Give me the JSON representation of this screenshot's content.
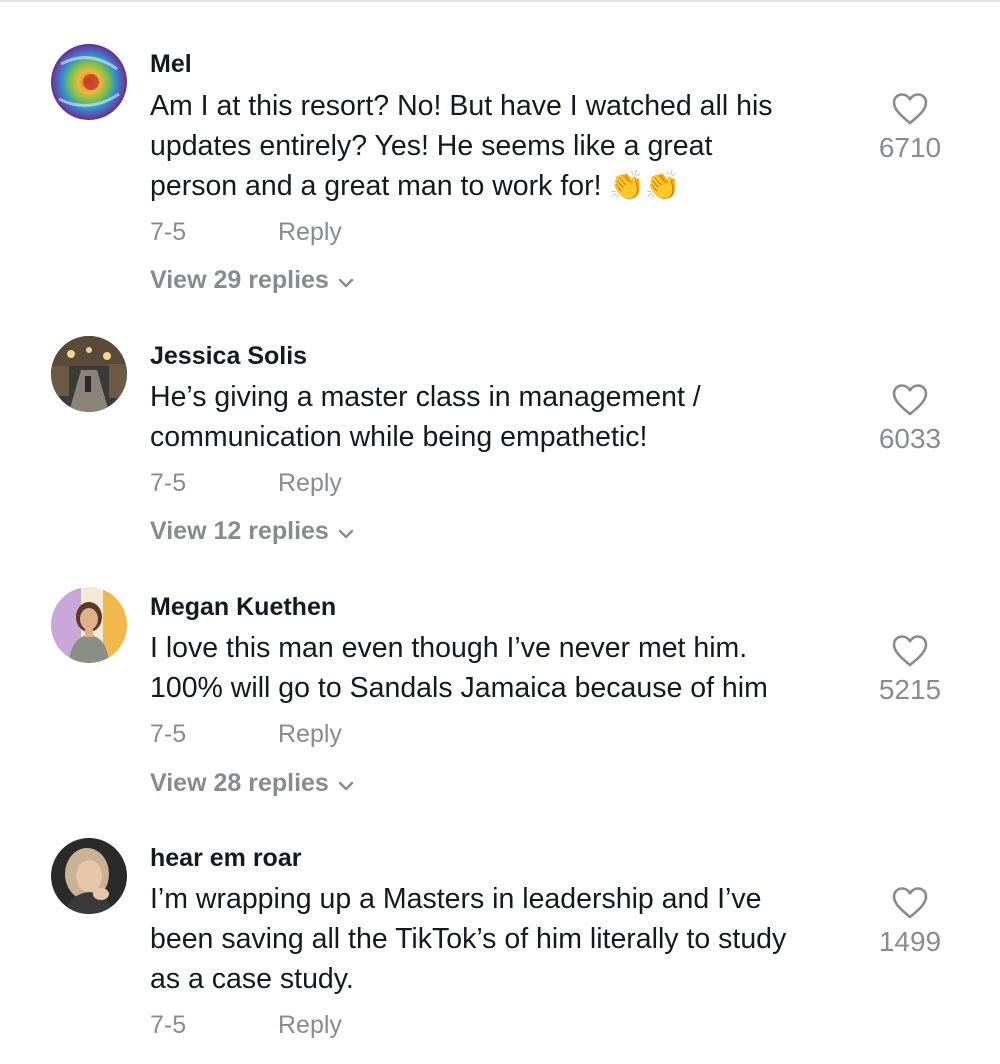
{
  "comments": [
    {
      "username": "Mel",
      "text": "Am I at this resort? No! But have I watched all his\nupdates entirely? Yes! He seems like a great\nperson and a great man to work for! 👏👏",
      "date": "7-5",
      "reply_label": "Reply",
      "view_replies": "View 29 replies",
      "likes": "6710",
      "avatar_icon": "tie-dye-avatar"
    },
    {
      "username": "Jessica Solis",
      "text": "He’s giving a master class in management /\ncommunication while being empathetic!",
      "date": "7-5",
      "reply_label": "Reply",
      "view_replies": "View 12 replies",
      "likes": "6033",
      "avatar_icon": "street-photo-avatar"
    },
    {
      "username": "Megan Kuethen",
      "text": "I love this man even though I’ve never met him.\n100% will go to Sandals Jamaica because of him",
      "date": "7-5",
      "reply_label": "Reply",
      "view_replies": "View 28 replies",
      "likes": "5215",
      "avatar_icon": "woman-portrait-avatar"
    },
    {
      "username": "hear em roar",
      "text": "I’m wrapping up a Masters in leadership and I’ve\nbeen saving all the TikTok’s of him literally to study\nas a case study.",
      "date": "7-5",
      "reply_label": "Reply",
      "likes": "1499",
      "avatar_icon": "woman-selfie-avatar"
    }
  ],
  "colors": {
    "text": "#161823",
    "muted": "#8a8b91"
  }
}
